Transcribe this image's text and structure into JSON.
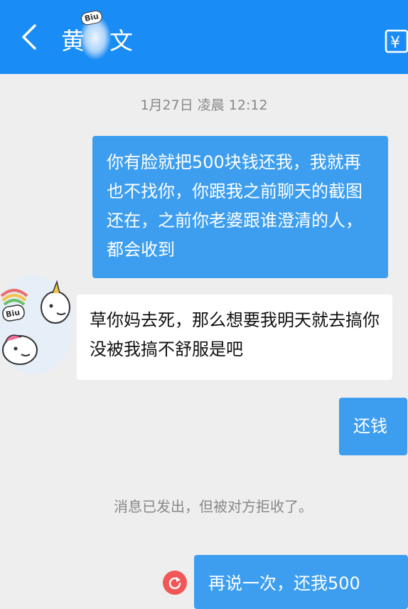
{
  "header": {
    "title_char_1": "黄",
    "title_char_2": "文",
    "sticker_text": "Biu",
    "transfer_symbol": "¥",
    "bg_color": "#1a8cf5"
  },
  "timestamp": "1月27日 凌晨 12:12",
  "messages": [
    {
      "direction": "out",
      "text": "你有脸就把500块钱还我，我就再也不找你，你跟我之前聊天的截图还在，之前你老婆跟谁澄清的人，都会收到"
    },
    {
      "direction": "in",
      "text": "草你妈去死，那么想要我明天就去搞你没被我搞不舒服是吧"
    },
    {
      "direction": "out",
      "text": "还钱"
    },
    {
      "direction": "out",
      "text": "再说一次，还我500"
    }
  ],
  "avatar": {
    "sticker_text": "Biu"
  },
  "notice": "消息已发出，但被对方拒收了。",
  "colors": {
    "out_bubble": "#3d9ef0",
    "in_bubble": "#ffffff",
    "resend": "#f25757"
  }
}
